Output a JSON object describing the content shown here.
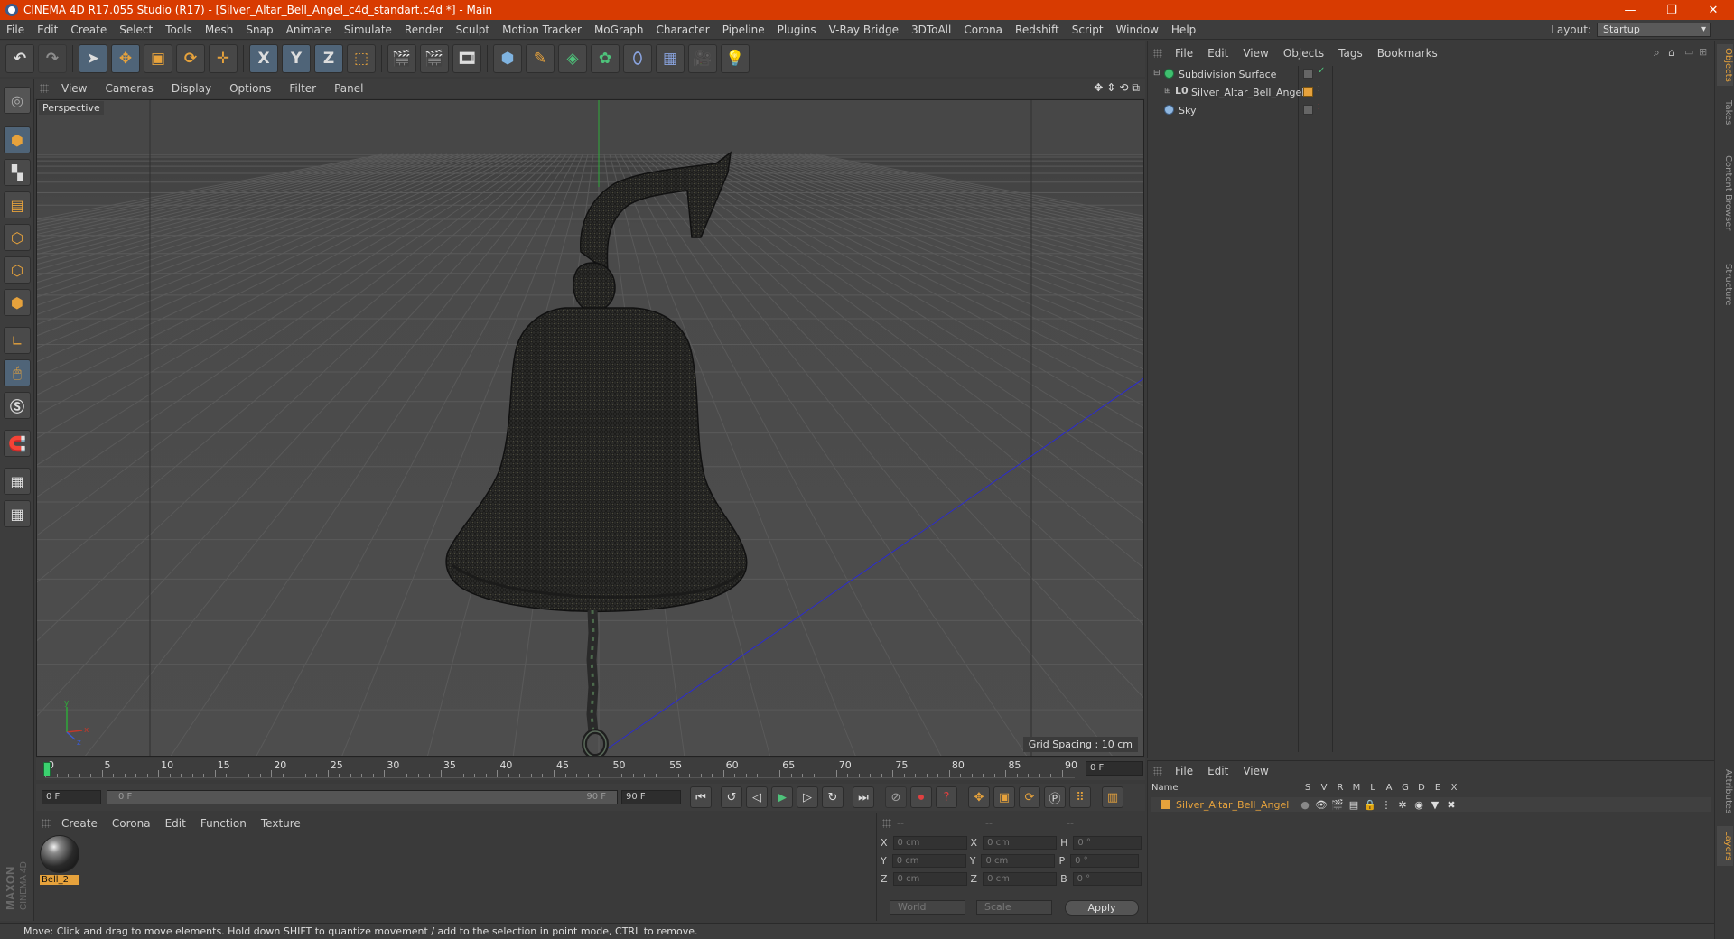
{
  "window": {
    "title": "CINEMA 4D R17.055 Studio (R17) - [Silver_Altar_Bell_Angel_c4d_standart.c4d *] - Main",
    "controls": {
      "minimize": "—",
      "restore": "❐",
      "close": "✕"
    }
  },
  "menubar": {
    "items": [
      "File",
      "Edit",
      "Create",
      "Select",
      "Tools",
      "Mesh",
      "Snap",
      "Animate",
      "Simulate",
      "Render",
      "Sculpt",
      "Motion Tracker",
      "MoGraph",
      "Character",
      "Pipeline",
      "Plugins",
      "V-Ray Bridge",
      "3DToAll",
      "Corona",
      "Redshift",
      "Script",
      "Window",
      "Help"
    ],
    "layout_label": "Layout:",
    "layout_value": "Startup"
  },
  "toolbar": {
    "x_label": "X",
    "y_label": "Y",
    "z_label": "Z"
  },
  "viewport": {
    "menu": [
      "View",
      "Cameras",
      "Display",
      "Options",
      "Filter",
      "Panel"
    ],
    "label": "Perspective",
    "grid_spacing": "Grid Spacing : 10 cm",
    "axis_y": "y",
    "axis_x": "x",
    "axis_z": "z"
  },
  "object_manager": {
    "menu": [
      "File",
      "Edit",
      "View",
      "Objects",
      "Tags",
      "Bookmarks"
    ],
    "objects": [
      {
        "name": "Subdivision Surface"
      },
      {
        "name": "Silver_Altar_Bell_Angel"
      },
      {
        "name": "Sky"
      }
    ]
  },
  "right_tabs": [
    "Objects",
    "Takes",
    "Content Browser",
    "Structure",
    "Attributes",
    "Layers"
  ],
  "timeline": {
    "ticks": [
      "0",
      "5",
      "10",
      "15",
      "20",
      "25",
      "30",
      "35",
      "40",
      "45",
      "50",
      "55",
      "60",
      "65",
      "70",
      "75",
      "80",
      "85",
      "90"
    ],
    "current_frame": "0 F"
  },
  "playback": {
    "start": "0 F",
    "slider_start": "0 F",
    "slider_end": "90 F",
    "end": "90 F"
  },
  "materials": {
    "menu": [
      "Create",
      "Corona",
      "Edit",
      "Function",
      "Texture"
    ],
    "items": [
      {
        "name": "Bell_2"
      }
    ]
  },
  "coordinates": {
    "header": [
      "--",
      "--",
      "--"
    ],
    "rows": [
      {
        "a_label": "X",
        "a_val": "0 cm",
        "b_label": "X",
        "b_val": "0 cm",
        "c_label": "H",
        "c_val": "0 °"
      },
      {
        "a_label": "Y",
        "a_val": "0 cm",
        "b_label": "Y",
        "b_val": "0 cm",
        "c_label": "P",
        "c_val": "0 °"
      },
      {
        "a_label": "Z",
        "a_val": "0 cm",
        "b_label": "Z",
        "b_val": "0 cm",
        "c_label": "B",
        "c_val": "0 °"
      }
    ],
    "space": "World",
    "mode": "Scale",
    "apply": "Apply"
  },
  "layers": {
    "menu": [
      "File",
      "Edit",
      "View"
    ],
    "columns": [
      "Name",
      "S",
      "V",
      "R",
      "M",
      "L",
      "A",
      "G",
      "D",
      "E",
      "X"
    ],
    "rows": [
      {
        "name": "Silver_Altar_Bell_Angel"
      }
    ]
  },
  "colors": {
    "title_bar": "#d83b01",
    "accent_orange": "#e6a23c",
    "layer_name": "#e6a23c"
  },
  "status": {
    "text": "Move: Click and drag to move elements. Hold down SHIFT to quantize movement / add to the selection in point mode, CTRL to remove."
  }
}
